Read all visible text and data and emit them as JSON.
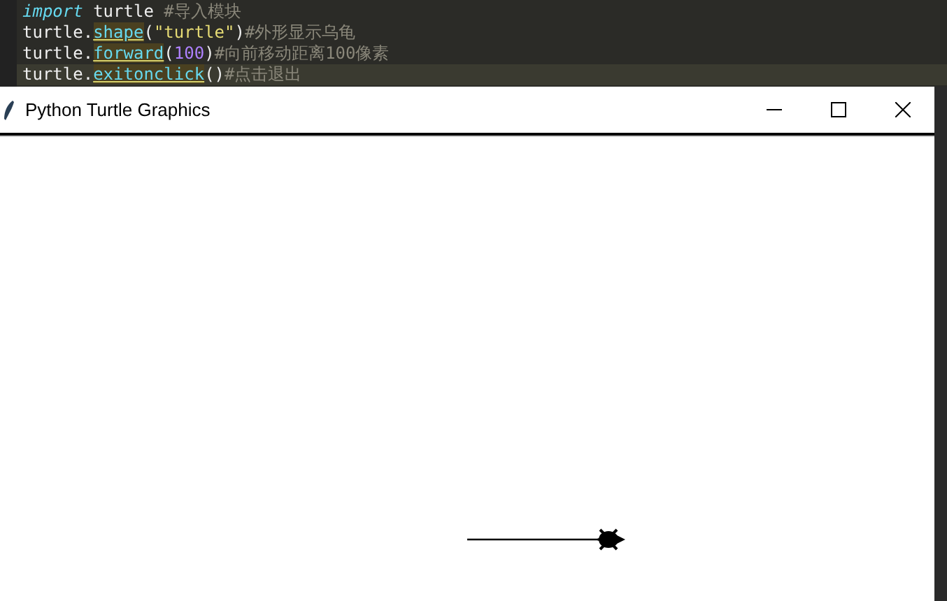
{
  "editor": {
    "lines": [
      {
        "highlighted": false,
        "tokens": [
          {
            "kind": "keyword",
            "text": "import"
          },
          {
            "kind": "plain",
            "text": " turtle "
          },
          {
            "kind": "comment",
            "text": "#导入模块"
          }
        ]
      },
      {
        "highlighted": false,
        "tokens": [
          {
            "kind": "plain",
            "text": "turtle."
          },
          {
            "kind": "call",
            "text": "shape"
          },
          {
            "kind": "plain",
            "text": "("
          },
          {
            "kind": "string",
            "text": "\"turtle\""
          },
          {
            "kind": "plain",
            "text": ")"
          },
          {
            "kind": "comment",
            "text": "#外形显示乌龟"
          }
        ]
      },
      {
        "highlighted": false,
        "tokens": [
          {
            "kind": "plain",
            "text": "turtle."
          },
          {
            "kind": "call",
            "text": "forward"
          },
          {
            "kind": "plain",
            "text": "("
          },
          {
            "kind": "number",
            "text": "100"
          },
          {
            "kind": "plain",
            "text": ")"
          },
          {
            "kind": "comment",
            "text": "#向前移动距离100像素"
          }
        ]
      },
      {
        "highlighted": true,
        "tokens": [
          {
            "kind": "plain",
            "text": "turtle."
          },
          {
            "kind": "call",
            "text": "exitonclick"
          },
          {
            "kind": "plain",
            "text": "()"
          },
          {
            "kind": "comment",
            "text": "#点击退出"
          }
        ]
      }
    ]
  },
  "window": {
    "title": "Python Turtle Graphics"
  }
}
